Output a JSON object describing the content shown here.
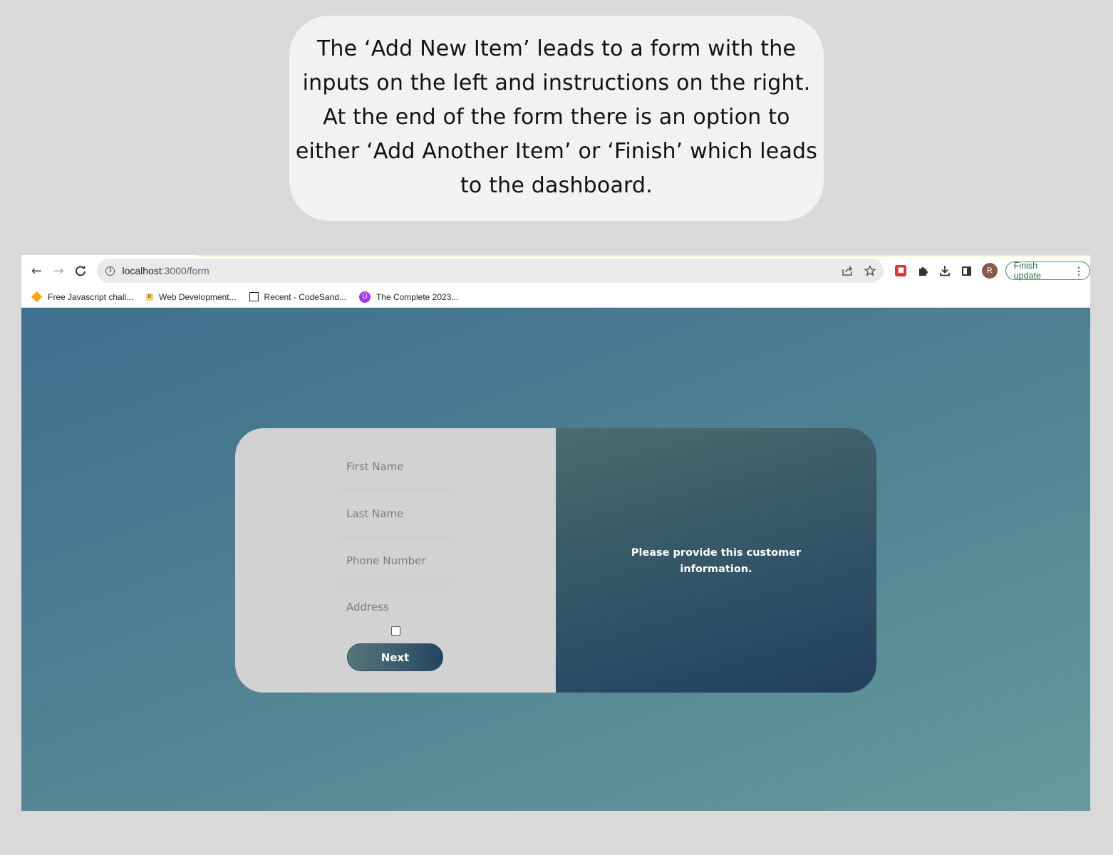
{
  "caption": {
    "text": "The ‘Add New Item’ leads to a form with the inputs on the left and instructions on the right. At the end of the form there is an option to either ‘Add Another Item’ or ‘Finish’ which leads to the dashboard."
  },
  "browser": {
    "nav": {
      "back_icon": "←",
      "forward_icon": "→",
      "reload_icon": "C"
    },
    "url": {
      "host": "localhost",
      "path": ":3000/form"
    },
    "update_button_label": "Finish update",
    "avatar_initial": "R",
    "bookmarks": [
      {
        "label": "Free Javascript chall...",
        "icon": "orange-diamond-icon"
      },
      {
        "label": "Web Development...",
        "icon": "webdev-favicon-icon"
      },
      {
        "label": "Recent - CodeSand...",
        "icon": "codesandbox-icon"
      },
      {
        "label": "The Complete 2023...",
        "icon": "udemy-icon"
      }
    ]
  },
  "form": {
    "fields": [
      {
        "name": "first-name",
        "placeholder": "First Name",
        "value": ""
      },
      {
        "name": "last-name",
        "placeholder": "Last Name",
        "value": ""
      },
      {
        "name": "phone-number",
        "placeholder": "Phone Number",
        "value": ""
      },
      {
        "name": "address",
        "placeholder": "Address",
        "value": ""
      }
    ],
    "checkbox_checked": false,
    "next_label": "Next",
    "instructions": "Please provide this customer information."
  },
  "colors": {
    "page_gradient_start": "#3f708f",
    "page_gradient_end": "#67999c",
    "card_left": "#d2d2d2",
    "card_right_start": "#4c6d6e",
    "card_right_end": "#223f5b",
    "update_accent": "#2f6b41"
  }
}
